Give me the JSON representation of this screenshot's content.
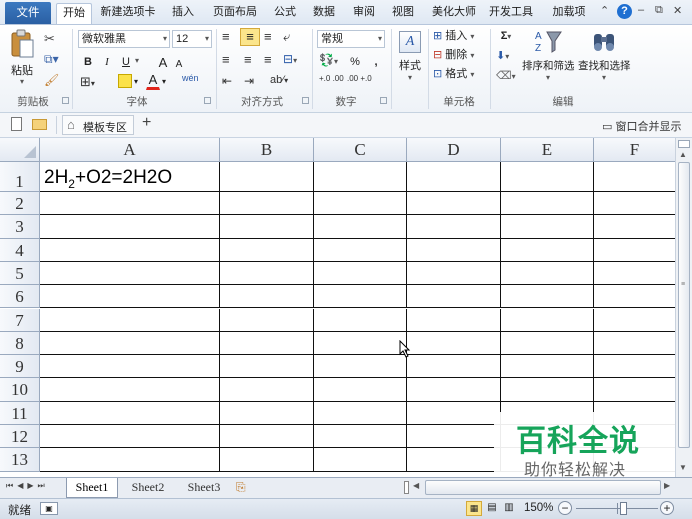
{
  "menu": {
    "file": "文件",
    "tabs": [
      "开始",
      "新建选项卡",
      "插入",
      "页面布局",
      "公式",
      "数据",
      "审阅",
      "视图",
      "美化大师",
      "开发工具",
      "加载项"
    ]
  },
  "ribbon": {
    "clipboard": {
      "paste": "粘贴",
      "label": "剪贴板"
    },
    "font": {
      "name": "微软雅黑",
      "size": "12",
      "bold": "B",
      "italic": "I",
      "underline": "U",
      "grow": "A",
      "shrink": "A",
      "font_color": "A",
      "phonetic": "wén",
      "label": "字体"
    },
    "alignment": {
      "label": "对齐方式"
    },
    "number": {
      "format": "常规",
      "percent": "%",
      "comma": ",",
      "inc": "+.0 .00",
      "dec": ".00 +.0",
      "label": "数字"
    },
    "styles": {
      "label": "样式"
    },
    "cells": {
      "insert": "插入",
      "delete": "删除",
      "format": "格式",
      "label": "单元格"
    },
    "editing": {
      "sum": "Σ",
      "sort_filter": "排序和筛选",
      "find_select": "查找和选择",
      "label": "编辑"
    }
  },
  "quickbar": {
    "template_zone": "模板专区",
    "add": "+",
    "merge_windows": "窗口合并显示"
  },
  "grid": {
    "columns": [
      "A",
      "B",
      "C",
      "D",
      "E",
      "F"
    ],
    "rows": [
      "1",
      "2",
      "3",
      "4",
      "5",
      "6",
      "7",
      "8",
      "9",
      "10",
      "11",
      "12",
      "13"
    ],
    "a1": {
      "pre": "2H",
      "sub": "2",
      "post": "+O2=2H2O"
    }
  },
  "sheets": [
    "Sheet1",
    "Sheet2",
    "Sheet3"
  ],
  "status": {
    "ready": "就绪",
    "zoom": "150%",
    "minus": "−",
    "plus": "+"
  },
  "watermark": {
    "title": "百科全说",
    "subtitle": "助你轻松解决"
  },
  "colors": {
    "file_tab": "#2a5fa3",
    "watermark_title": "#16a45a",
    "highlight": "#fbe58c"
  }
}
